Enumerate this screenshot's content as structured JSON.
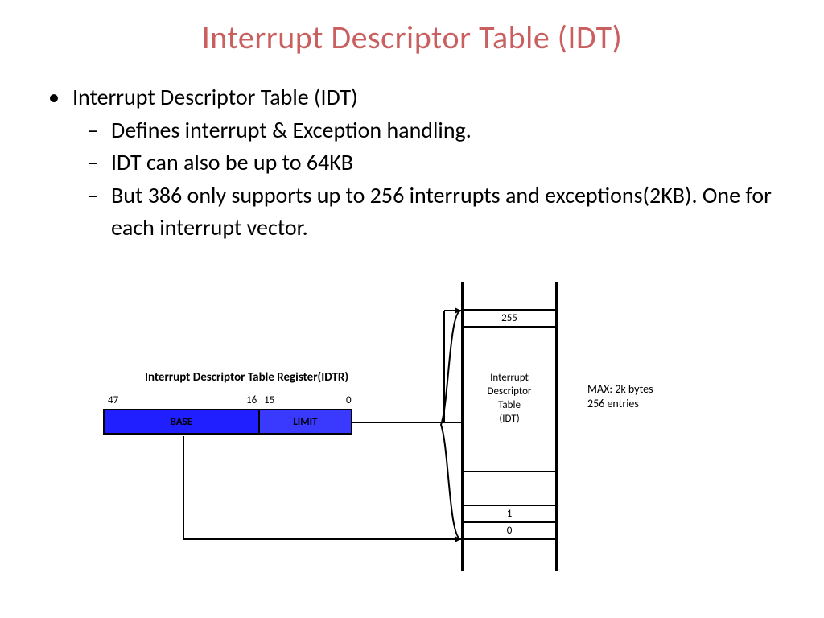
{
  "title": "Interrupt Descriptor Table (IDT)",
  "bullets": {
    "main": "Interrupt Descriptor Table (IDT)",
    "sub1": "Defines interrupt & Exception handling.",
    "sub2": "IDT can also be up to 64KB",
    "sub3": "But 386 only supports up to 256 interrupts and exceptions(2KB). One for each interrupt vector."
  },
  "diagram": {
    "idtr_title": "Interrupt Descriptor Table Register(IDTR)",
    "bit47": "47",
    "bit16": "16",
    "bit15": "15",
    "bit0": "0",
    "base_label": "BASE",
    "limit_label": "LIMIT",
    "entry_top": "255",
    "mid_l1": "Interrupt",
    "mid_l2": "Descriptor",
    "mid_l3": "Table",
    "mid_l4": "(IDT)",
    "entry_1": "1",
    "entry_0": "0",
    "max_l1": "MAX: 2k bytes",
    "max_l2": "256 entries"
  }
}
